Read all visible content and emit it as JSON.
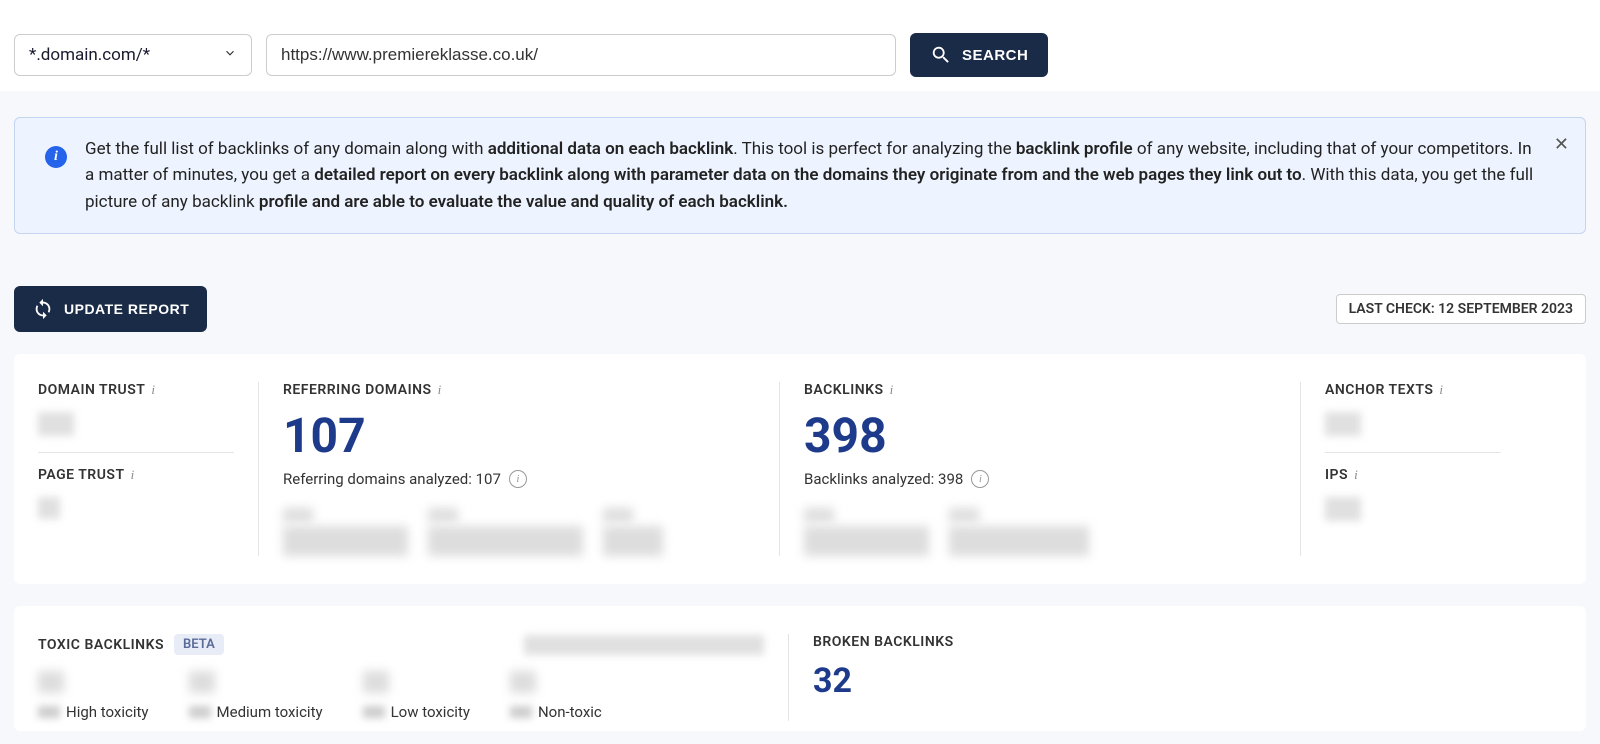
{
  "search": {
    "scope": "*.domain.com/*",
    "url": "https://www.premiereklasse.co.uk/",
    "button": "SEARCH"
  },
  "banner": {
    "t1": "Get the full list of backlinks of any domain along with ",
    "b1": "additional data on each backlink",
    "t2": ". This tool is perfect for analyzing the ",
    "b2": "backlink profile",
    "t3": " of any website, including that of your competitors. In a matter of minutes, you get a ",
    "b3": "detailed report on every backlink along with parameter data on the domains they originate from and the web pages they link out to",
    "t4": ". With this data, you get the full picture of any backlink ",
    "b4": "profile and are able to evaluate the value and quality of each backlink."
  },
  "controls": {
    "update": "UPDATE REPORT",
    "last_check": "LAST CHECK: 12 SEPTEMBER 2023"
  },
  "metrics": {
    "domain_trust": "DOMAIN TRUST",
    "page_trust": "PAGE TRUST",
    "ref_domains": "REFERRING DOMAINS",
    "ref_val": "107",
    "ref_sub": "Referring domains analyzed: 107",
    "backlinks": "BACKLINKS",
    "bl_val": "398",
    "bl_sub": "Backlinks analyzed: 398",
    "anchor": "ANCHOR TEXTS",
    "ips": "IPS"
  },
  "toxic": {
    "title": "TOXIC BACKLINKS",
    "beta": "BETA",
    "high": "High toxicity",
    "medium": "Medium toxicity",
    "low": "Low toxicity",
    "non": "Non-toxic"
  },
  "broken": {
    "title": "BROKEN BACKLINKS",
    "val": "32"
  }
}
